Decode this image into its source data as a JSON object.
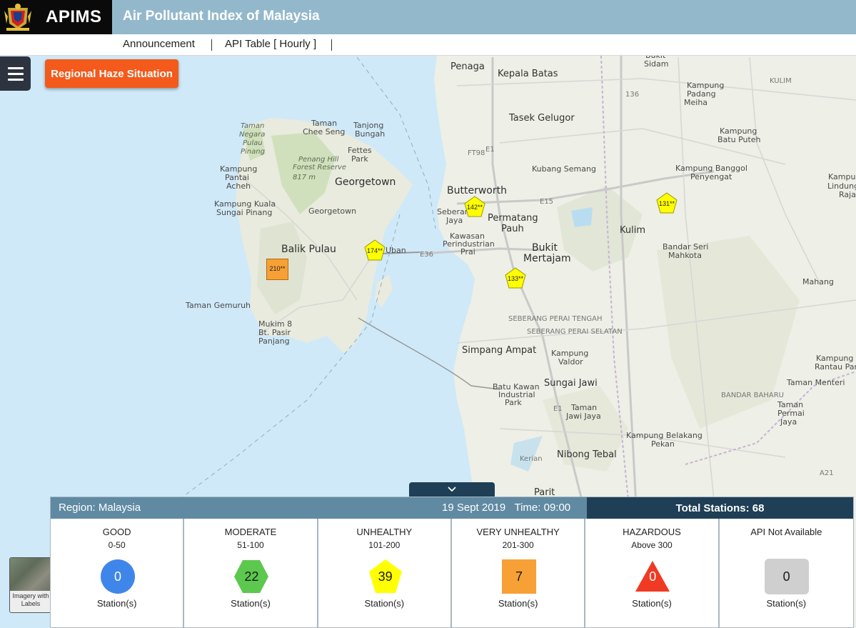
{
  "header": {
    "brand": "APIMS",
    "title": "Air Pollutant Index of Malaysia",
    "crest_icon": "malaysia-coat-of-arms"
  },
  "subnav": {
    "items": [
      {
        "label": "Announcement"
      },
      {
        "label": "API Table [ Hourly ]"
      }
    ]
  },
  "haze_button": {
    "label": "Regional Haze Situation"
  },
  "map": {
    "labels": [
      "Penaga",
      "Kepala Batas",
      "Bukit",
      "Sidam",
      "Kampung",
      "Padang",
      "Meiha",
      "Tasek Gelugor",
      "Kampung",
      "Batu Puteh",
      "Taman",
      "Negara",
      "Pulau",
      "Pinang",
      "Taman",
      "Chee Seng",
      "Tanjong",
      "Bungah",
      "Fettes",
      "Park",
      "Penang Hill",
      "Forest Reserve",
      "817 m",
      "Kampung",
      "Pantai",
      "Acheh",
      "Georgetown",
      "Kampung Kuala",
      "Sungai Pinang",
      "Georgetown",
      "Butterworth",
      "Kubang Semang",
      "Kampung Banggol",
      "Penyengat",
      "Seberang",
      "Jaya",
      "Permatang",
      "Pauh",
      "Kulim",
      "Kawasan",
      "Perindustrian",
      "Prai",
      "Balik Pulau",
      "Uban",
      "Bukit",
      "Mertajam",
      "Bandar Seri",
      "Mahkota",
      "Taman Gemuruh",
      "Mahang",
      "SEBERANG PERAI TENGAH",
      "SEBERANG PERAI SELATAN",
      "Mukim 8",
      "Bt. Pasir",
      "Panjang",
      "Simpang Ampat",
      "Kampung",
      "Valdor",
      "BANDAR BAHARU",
      "Batu Kawan",
      "Industrial",
      "Park",
      "Sungai Jawi",
      "Taman Menteri",
      "Taman",
      "Jawi Jaya",
      "Taman",
      "Permai",
      "Jaya",
      "Kampung Belakang",
      "Pekan",
      "Nibong Tebal",
      "Kerian",
      "Parit",
      "Kampung",
      "Rantau Pan",
      "Kampung",
      "Lindung",
      "Raja",
      "KULIM"
    ],
    "roads": [
      "E1",
      "FT98",
      "E15",
      "E36",
      "136",
      "A21",
      "E1"
    ],
    "markers": [
      {
        "value": "210**",
        "category": "very-unhealthy",
        "color": "#f7a035"
      },
      {
        "value": "174**",
        "category": "unhealthy",
        "color": "#ffff00"
      },
      {
        "value": "142**",
        "category": "unhealthy",
        "color": "#ffff00"
      },
      {
        "value": "133**",
        "category": "unhealthy",
        "color": "#ffff00"
      },
      {
        "value": "131**",
        "category": "unhealthy",
        "color": "#ffff00"
      }
    ],
    "basemap_label": "Imagery with Labels"
  },
  "panel": {
    "region": "Region: Malaysia",
    "date": "19 Sept 2019",
    "time": "Time: 09:00",
    "total": "Total Stations: 68",
    "categories": [
      {
        "name": "GOOD",
        "range": "0-50",
        "count": "0",
        "footer": "Station(s)",
        "shape": "circle",
        "color": "#3f86ea",
        "text_color": "#ffffff"
      },
      {
        "name": "MODERATE",
        "range": "51-100",
        "count": "22",
        "footer": "Station(s)",
        "shape": "hexagon",
        "color": "#5cc84e",
        "text_color": "#1a1a1a"
      },
      {
        "name": "UNHEALTHY",
        "range": "101-200",
        "count": "39",
        "footer": "Station(s)",
        "shape": "pentagon",
        "color": "#ffff00",
        "text_color": "#1a1a1a"
      },
      {
        "name": "VERY UNHEALTHY",
        "range": "201-300",
        "count": "7",
        "footer": "Station(s)",
        "shape": "square",
        "color": "#f7a035",
        "text_color": "#1a1a1a"
      },
      {
        "name": "HAZARDOUS",
        "range": "Above 300",
        "count": "0",
        "footer": "Station(s)",
        "shape": "triangle",
        "color": "#f03a23",
        "text_color": "#ffffff"
      },
      {
        "name": "API Not Available",
        "range": "",
        "count": "0",
        "footer": "Station(s)",
        "shape": "rounded-square",
        "color": "#cfcfcf",
        "text_color": "#1a1a1a"
      }
    ]
  }
}
